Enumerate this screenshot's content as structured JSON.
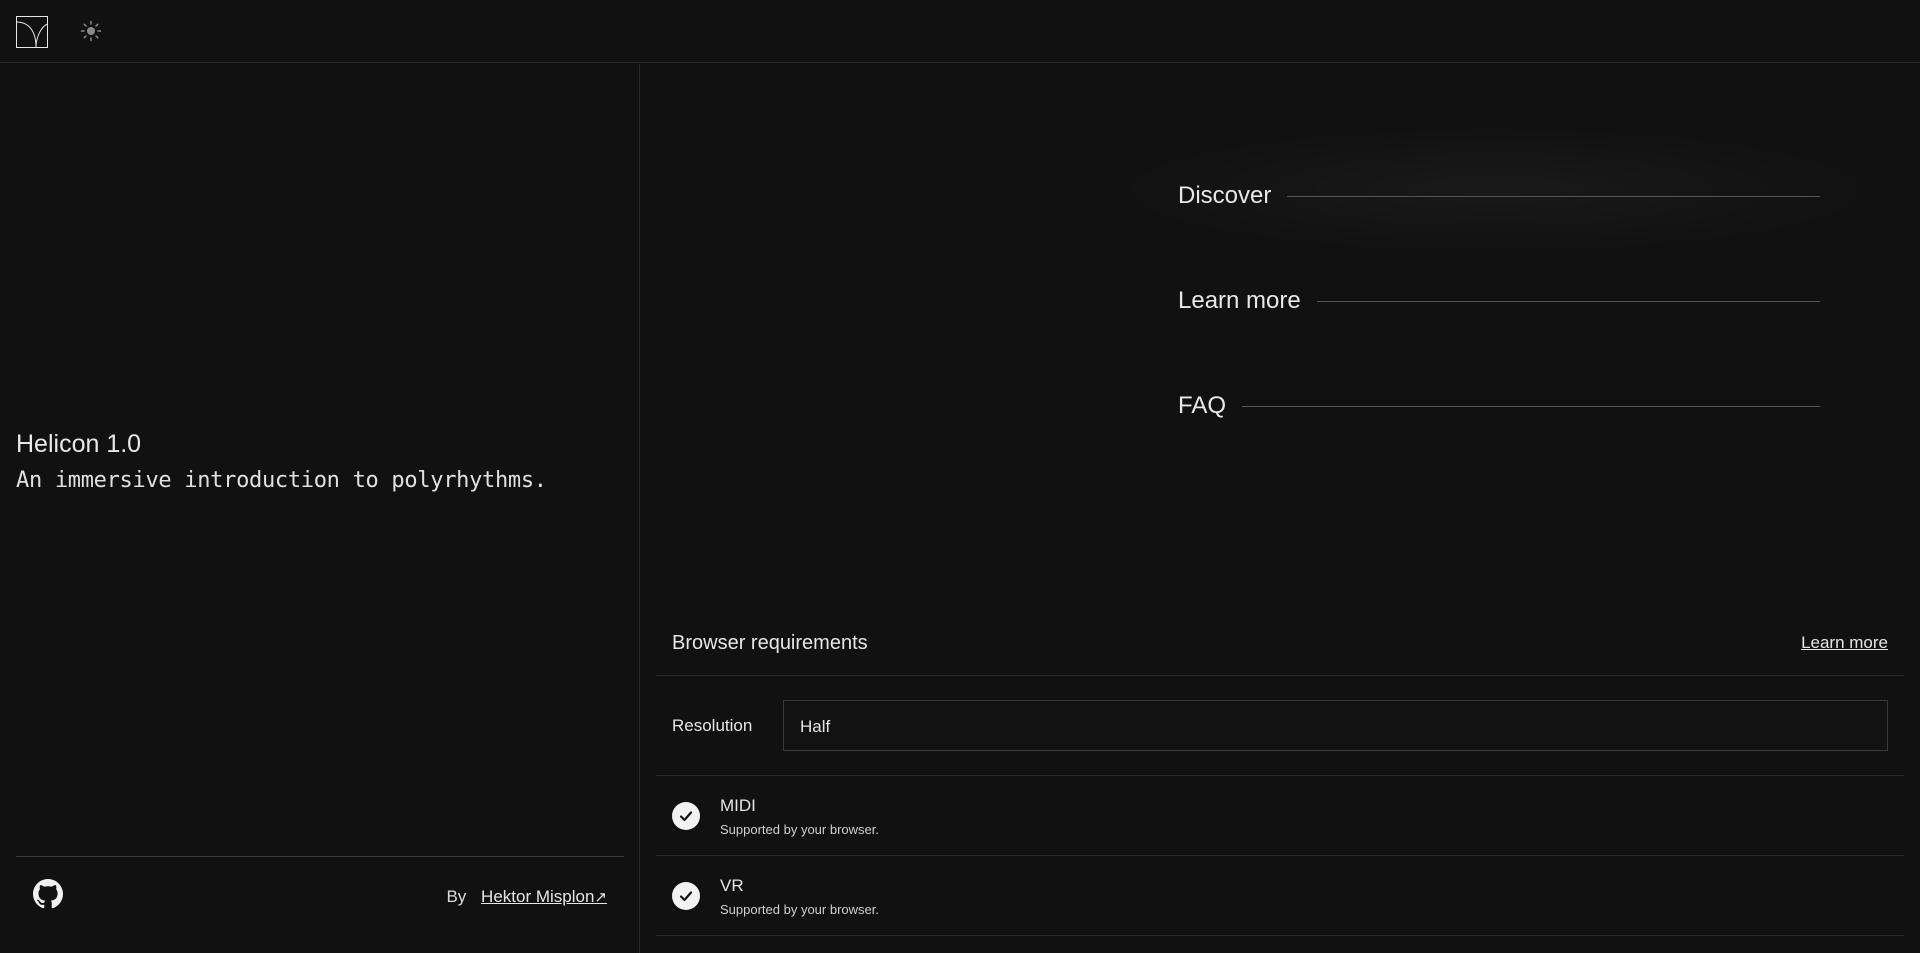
{
  "header": {
    "logo_icon": "helicon-logo-icon",
    "theme_icon": "sun-icon"
  },
  "intro": {
    "title": "Helicon 1.0",
    "tagline": "An immersive introduction to polyrhythms."
  },
  "footer": {
    "github_icon": "github-icon",
    "by_label": "By",
    "author": "Hektor Misplon",
    "author_arrow": "↗"
  },
  "nav": {
    "items": [
      {
        "label": "Discover"
      },
      {
        "label": "Learn more"
      },
      {
        "label": "FAQ"
      }
    ]
  },
  "requirements": {
    "title": "Browser requirements",
    "learn_more": "Learn more",
    "resolution": {
      "label": "Resolution",
      "value": "Half"
    },
    "features": [
      {
        "name": "MIDI",
        "status": "Supported by your browser.",
        "icon": "check-icon"
      },
      {
        "name": "VR",
        "status": "Supported by your browser.",
        "icon": "check-icon"
      }
    ]
  },
  "colors": {
    "background": "#111111",
    "text": "#e6e6e6",
    "divider": "#2a2a2a",
    "check_bg": "#f2f2f2"
  }
}
